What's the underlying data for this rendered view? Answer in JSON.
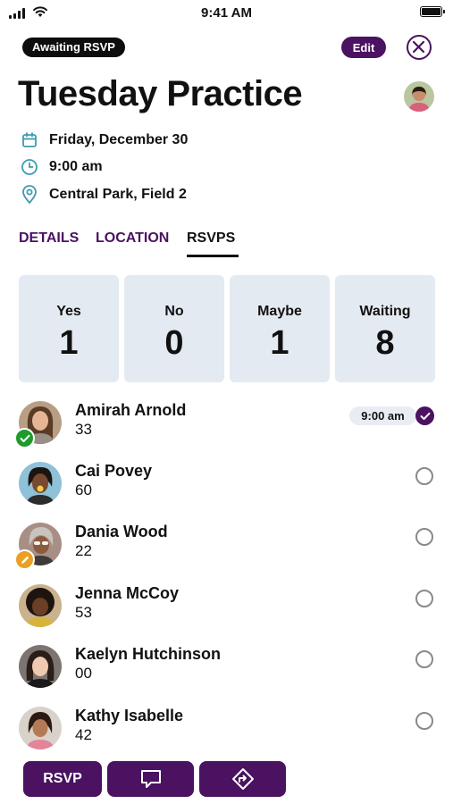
{
  "status_bar": {
    "time": "9:41 AM"
  },
  "event": {
    "status_badge": "Awaiting RSVP",
    "edit_label": "Edit",
    "title": "Tuesday Practice",
    "date": "Friday, December 30",
    "time": "9:00 am",
    "location": "Central Park, Field 2"
  },
  "tabs": [
    {
      "label": "DETAILS"
    },
    {
      "label": "LOCATION"
    },
    {
      "label": "RSVPS",
      "active": true
    }
  ],
  "summary": [
    {
      "label": "Yes",
      "count": "1"
    },
    {
      "label": "No",
      "count": "0"
    },
    {
      "label": "Maybe",
      "count": "1"
    },
    {
      "label": "Waiting",
      "count": "8"
    }
  ],
  "attendees": [
    {
      "name": "Amirah Arnold",
      "number": "33",
      "rsvp_time": "9:00 am",
      "status": "yes",
      "selected": true
    },
    {
      "name": "Cai Povey",
      "number": "60",
      "status": "waiting",
      "selected": false
    },
    {
      "name": "Dania Wood",
      "number": "22",
      "status": "maybe",
      "selected": false
    },
    {
      "name": "Jenna McCoy",
      "number": "53",
      "status": "waiting",
      "selected": false
    },
    {
      "name": "Kaelyn Hutchinson",
      "number": "00",
      "status": "waiting",
      "selected": false
    },
    {
      "name": "Kathy Isabelle",
      "number": "42",
      "status": "waiting",
      "selected": false
    }
  ],
  "bottom_bar": {
    "rsvp_label": "RSVP",
    "message_icon": "chat-bubble-icon",
    "directions_icon": "directions-icon"
  },
  "colors": {
    "accent": "#4a1260",
    "card_bg": "#e4eaf2",
    "yes_green": "#1f9a2c",
    "maybe_orange": "#e9a024",
    "calendar_icon": "#3f9bb0"
  }
}
